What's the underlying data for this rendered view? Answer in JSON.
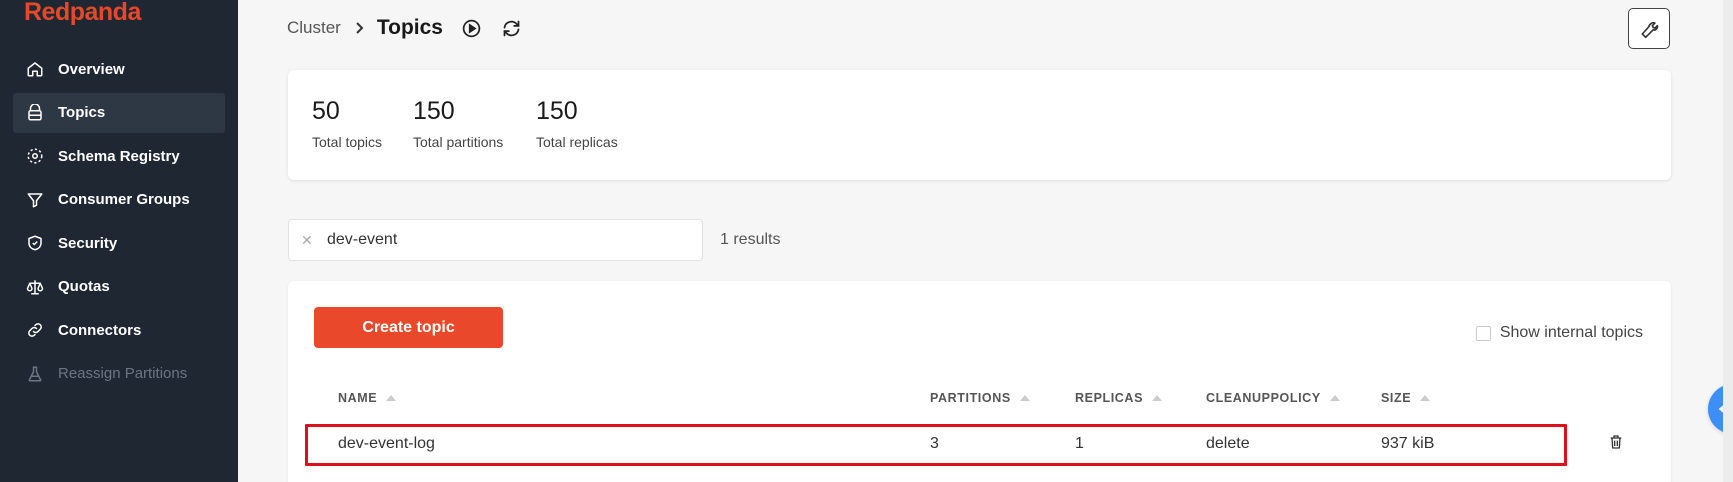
{
  "app": {
    "logo": "Redpanda"
  },
  "sidebar": {
    "items": [
      {
        "label": "Overview",
        "icon": "home-icon"
      },
      {
        "label": "Topics",
        "icon": "topics-icon",
        "active": true
      },
      {
        "label": "Schema Registry",
        "icon": "schema-icon"
      },
      {
        "label": "Consumer Groups",
        "icon": "filter-icon"
      },
      {
        "label": "Security",
        "icon": "shield-icon"
      },
      {
        "label": "Quotas",
        "icon": "scale-icon"
      },
      {
        "label": "Connectors",
        "icon": "link-icon"
      },
      {
        "label": "Reassign Partitions",
        "icon": "beaker-icon",
        "disabled": true
      }
    ]
  },
  "breadcrumb": {
    "parent": "Cluster",
    "title": "Topics"
  },
  "stats": [
    {
      "value": "50",
      "label": "Total topics"
    },
    {
      "value": "150",
      "label": "Total partitions"
    },
    {
      "value": "150",
      "label": "Total replicas"
    }
  ],
  "search": {
    "value": "dev-event",
    "results": "1 results"
  },
  "actions": {
    "create_topic": "Create topic",
    "show_internal": "Show internal topics"
  },
  "table": {
    "columns": [
      "NAME",
      "PARTITIONS",
      "REPLICAS",
      "CLEANUPPOLICY",
      "SIZE"
    ],
    "rows": [
      {
        "name": "dev-event-log",
        "partitions": "3",
        "replicas": "1",
        "cleanup": "delete",
        "size": "937 kiB"
      }
    ]
  },
  "colors": {
    "brand": "#e5492a",
    "sidebar": "#1f2733",
    "highlight": "#e0101a",
    "accent": "#3d8ff5"
  }
}
